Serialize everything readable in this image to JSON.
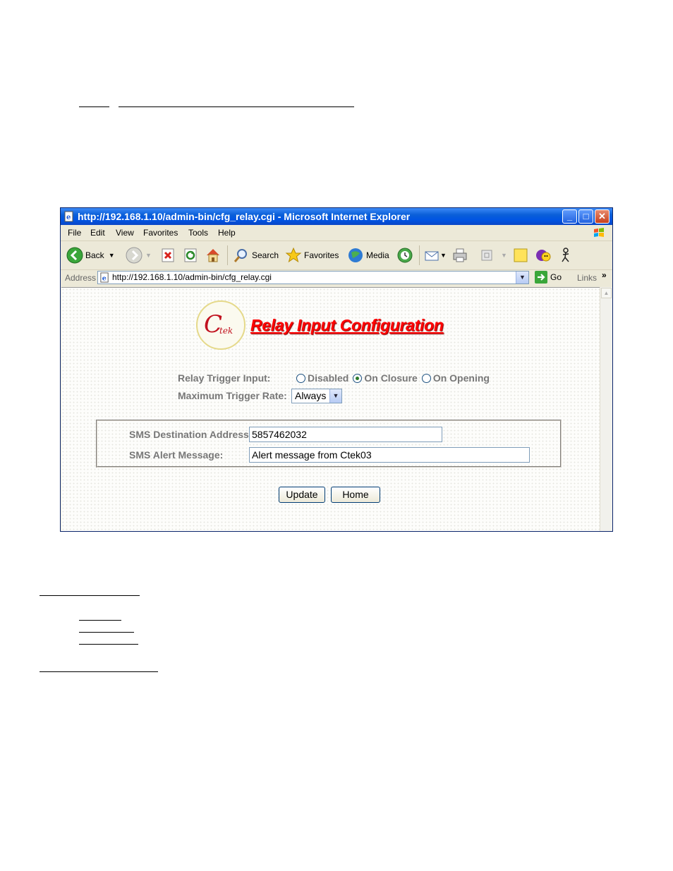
{
  "window": {
    "title": "http://192.168.1.10/admin-bin/cfg_relay.cgi - Microsoft Internet Explorer",
    "minimize": "_",
    "maximize": "□",
    "close": "✕"
  },
  "menubar": [
    "File",
    "Edit",
    "View",
    "Favorites",
    "Tools",
    "Help"
  ],
  "toolbar": {
    "back": "Back",
    "search": "Search",
    "favorites": "Favorites",
    "media": "Media"
  },
  "addressbar": {
    "label": "Address",
    "url": "http://192.168.1.10/admin-bin/cfg_relay.cgi",
    "go": "Go",
    "links": "Links",
    "more": "»"
  },
  "page": {
    "title": "Relay Input Configuration",
    "relay_trigger_label": "Relay Trigger Input:",
    "radio_options": [
      {
        "label": "Disabled",
        "checked": false
      },
      {
        "label": "On Closure",
        "checked": true
      },
      {
        "label": "On Opening",
        "checked": false
      }
    ],
    "max_rate_label": "Maximum Trigger Rate:",
    "max_rate_value": "Always",
    "sms_dest_label": "SMS Destination Address:",
    "sms_dest_value": "5857462032",
    "sms_msg_label": "SMS Alert Message:",
    "sms_msg_value": "Alert message from Ctek03",
    "update_button": "Update",
    "home_button": "Home"
  },
  "colors": {
    "title_red": "#ff0000",
    "xp_blue": "#0054e3"
  }
}
